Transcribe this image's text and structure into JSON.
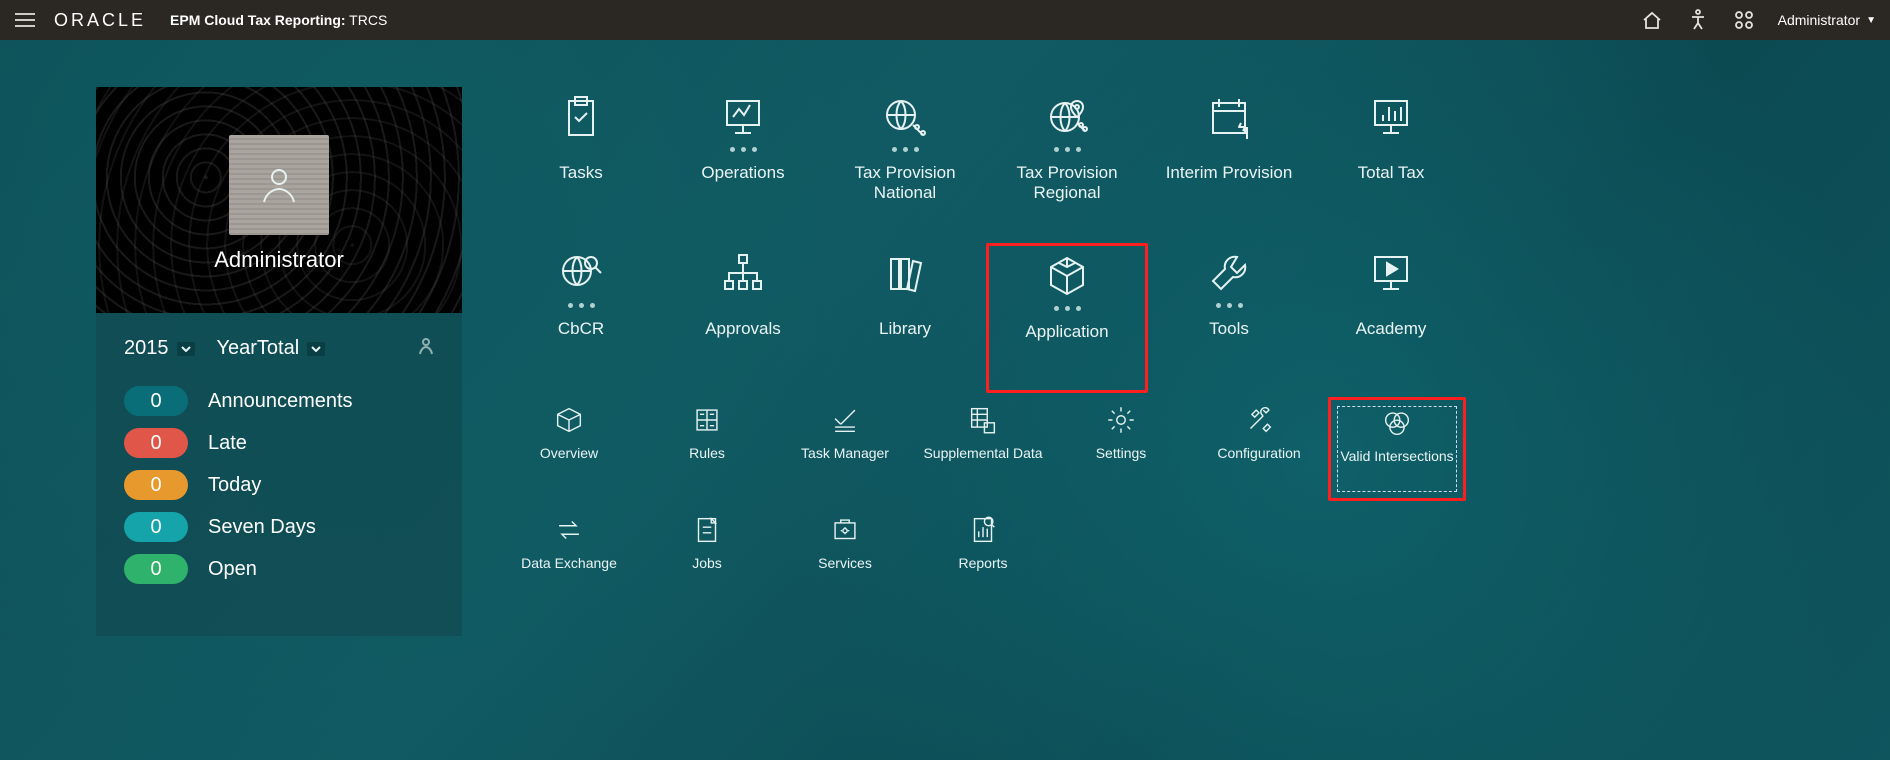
{
  "header": {
    "logo": "ORACLE",
    "title_main": "EPM Cloud Tax Reporting:",
    "title_sub": " TRCS",
    "user_label": "Administrator"
  },
  "profile": {
    "name": "Administrator"
  },
  "filters": {
    "year": "2015",
    "period": "YearTotal"
  },
  "stats": [
    {
      "count": "0",
      "label": "Announcements",
      "color": "#0a6e79"
    },
    {
      "count": "0",
      "label": "Late",
      "color": "#e05648"
    },
    {
      "count": "0",
      "label": "Today",
      "color": "#e8992e"
    },
    {
      "count": "0",
      "label": "Seven Days",
      "color": "#15a4a9"
    },
    {
      "count": "0",
      "label": "Open",
      "color": "#2fb26b"
    }
  ],
  "clusters": [
    {
      "label": "Tasks",
      "icon": "clipboard",
      "dots": false
    },
    {
      "label": "Operations",
      "icon": "monitor",
      "dots": true
    },
    {
      "label": "Tax Provision\nNational",
      "icon": "globe-pct",
      "dots": true
    },
    {
      "label": "Tax Provision\nRegional",
      "icon": "globe-pin",
      "dots": true
    },
    {
      "label": "Interim Provision",
      "icon": "calendar-s",
      "dots": false
    },
    {
      "label": "Total Tax",
      "icon": "chart",
      "dots": false
    },
    {
      "label": "CbCR",
      "icon": "globe-mag",
      "dots": true
    },
    {
      "label": "Approvals",
      "icon": "org",
      "dots": false
    },
    {
      "label": "Library",
      "icon": "books",
      "dots": false
    },
    {
      "label": "Application",
      "icon": "cube",
      "dots": true,
      "highlight": true
    },
    {
      "label": "Tools",
      "icon": "wrench",
      "dots": true
    },
    {
      "label": "Academy",
      "icon": "play",
      "dots": false
    }
  ],
  "subitems": [
    {
      "label": "Overview",
      "icon": "box"
    },
    {
      "label": "Rules",
      "icon": "grid"
    },
    {
      "label": "Task Manager",
      "icon": "check"
    },
    {
      "label": "Supplemental Data",
      "icon": "datasheet"
    },
    {
      "label": "Settings",
      "icon": "gear"
    },
    {
      "label": "Configuration",
      "icon": "tools"
    },
    {
      "label": "Valid Intersections",
      "icon": "venn",
      "highlight": true
    },
    {
      "label": "Data Exchange",
      "icon": "exchange"
    },
    {
      "label": "Jobs",
      "icon": "jobs"
    },
    {
      "label": "Services",
      "icon": "services"
    },
    {
      "label": "Reports",
      "icon": "report"
    }
  ]
}
